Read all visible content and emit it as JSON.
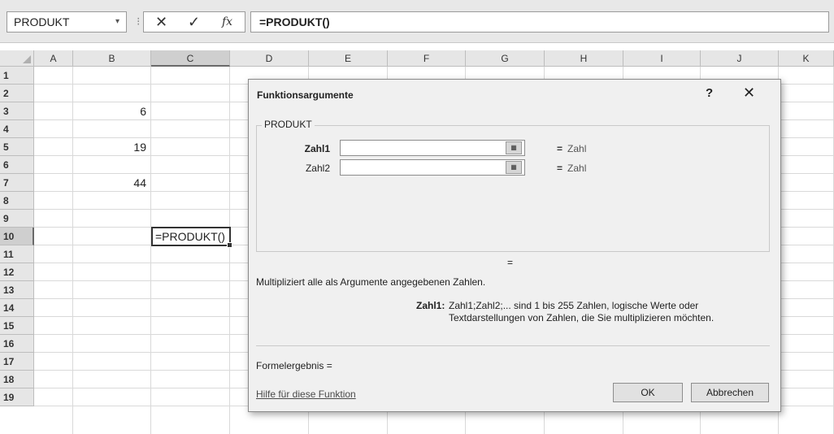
{
  "formula_bar": {
    "name_box": "PRODUKT",
    "name_box_arrow": "▾",
    "separator": "⁝",
    "cancel_glyph": "✕",
    "enter_glyph": "✓",
    "fx_glyph": "fx",
    "formula": "=PRODUKT()"
  },
  "sheet": {
    "columns": [
      "A",
      "B",
      "C",
      "D",
      "E",
      "F",
      "G",
      "H",
      "I",
      "J",
      "K"
    ],
    "rows": [
      "1",
      "2",
      "3",
      "4",
      "5",
      "6",
      "7",
      "8",
      "9",
      "10",
      "11",
      "12",
      "13",
      "14",
      "15",
      "16",
      "17",
      "18",
      "19"
    ],
    "selected_column": "C",
    "selected_row": "10",
    "values": {
      "B3": "6",
      "B5": "19",
      "B7": "44"
    },
    "active_cell": {
      "ref": "C10",
      "text": "=PRODUKT()"
    }
  },
  "dialog": {
    "title": "Funktionsargumente",
    "help_glyph": "?",
    "close_glyph": "✕",
    "group_label": "PRODUKT",
    "args": [
      {
        "label": "Zahl1",
        "result_eq": "=",
        "result": "Zahl"
      },
      {
        "label": "Zahl2",
        "result_eq": "=",
        "result": "Zahl"
      }
    ],
    "ref_button_glyph": "▦",
    "result_eq": "=",
    "description": "Multipliziert alle als Argumente angegebenen Zahlen.",
    "arg_help_name": "Zahl1:",
    "arg_help_line1": "Zahl1;Zahl2;... sind 1 bis 255 Zahlen, logische Werte oder",
    "arg_help_line2": "Textdarstellungen von Zahlen, die Sie multiplizieren möchten.",
    "formula_result": "Formelergebnis =",
    "help_link": "Hilfe für diese Funktion",
    "ok": "OK",
    "cancel": "Abbrechen"
  }
}
